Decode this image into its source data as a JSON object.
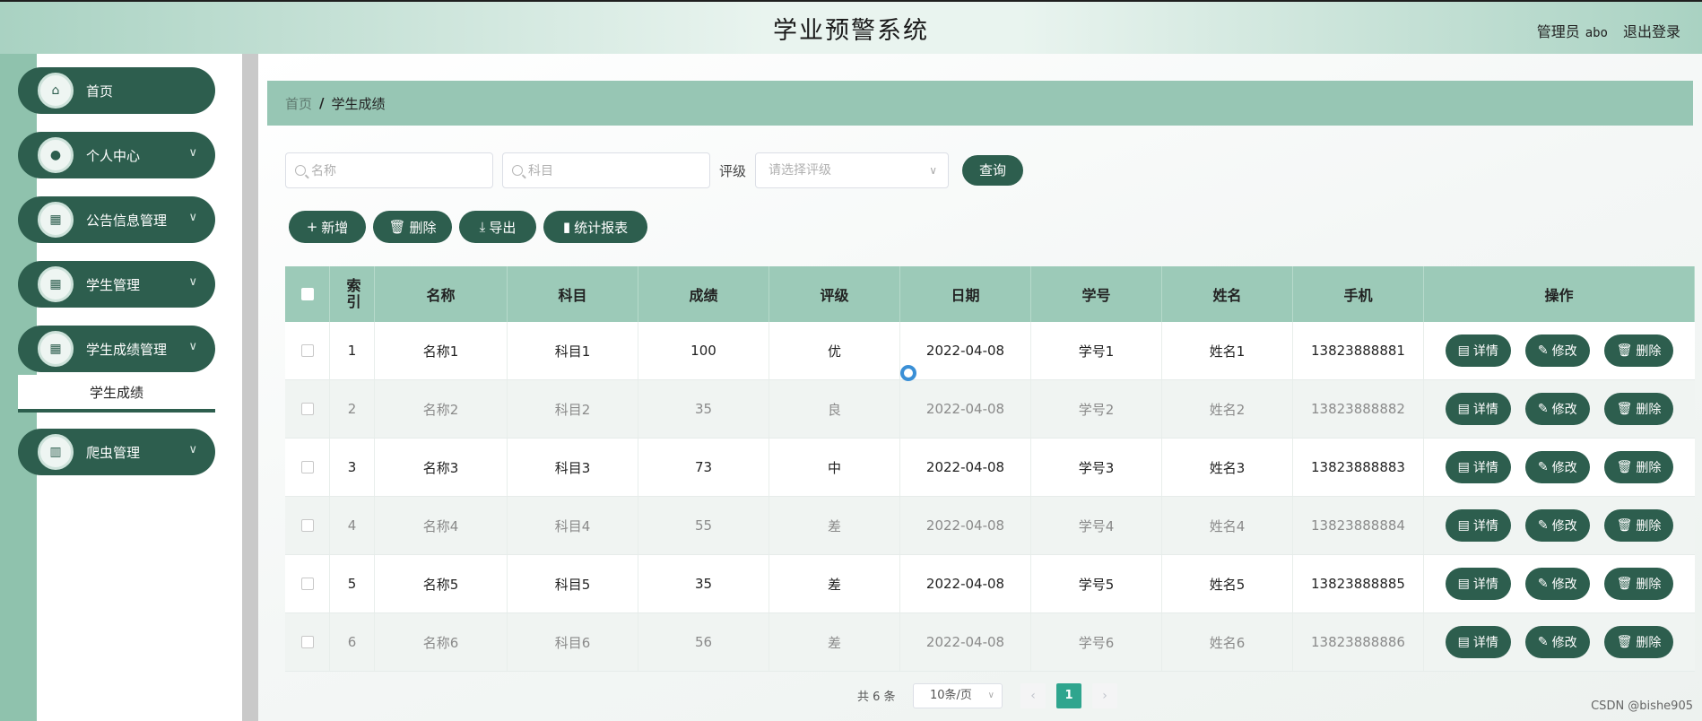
{
  "header": {
    "title": "学业预警系统",
    "user_label": "管理员",
    "username": "abo",
    "logout": "退出登录"
  },
  "sidebar": {
    "items": [
      {
        "label": "首页",
        "icon": "home-icon",
        "glyph": "⌂"
      },
      {
        "label": "个人中心",
        "icon": "user-icon",
        "glyph": "●"
      },
      {
        "label": "公告信息管理",
        "icon": "grid-icon",
        "glyph": "▦"
      },
      {
        "label": "学生管理",
        "icon": "grid-icon",
        "glyph": "▦"
      },
      {
        "label": "学生成绩管理",
        "icon": "apps-icon",
        "glyph": "▦"
      },
      {
        "label": "爬虫管理",
        "icon": "columns-icon",
        "glyph": "▥"
      }
    ],
    "active_sub": "学生成绩"
  },
  "breadcrumb": {
    "home": "首页",
    "current": "学生成绩"
  },
  "search": {
    "name_placeholder": "名称",
    "subject_placeholder": "科目",
    "rating_label": "评级",
    "rating_placeholder": "请选择评级",
    "query": "查询"
  },
  "toolbar": {
    "add": "新增",
    "delete": "删除",
    "export": "导出",
    "report": "统计报表"
  },
  "table": {
    "headers": {
      "index": "索引",
      "name": "名称",
      "subject": "科目",
      "score": "成绩",
      "rating": "评级",
      "date": "日期",
      "student_no": "学号",
      "student_name": "姓名",
      "phone": "手机",
      "ops": "操作"
    },
    "rows": [
      {
        "index": "1",
        "name": "名称1",
        "subject": "科目1",
        "score": "100",
        "rating": "优",
        "date": "2022-04-08",
        "student_no": "学号1",
        "student_name": "姓名1",
        "phone": "13823888881"
      },
      {
        "index": "2",
        "name": "名称2",
        "subject": "科目2",
        "score": "35",
        "rating": "良",
        "date": "2022-04-08",
        "student_no": "学号2",
        "student_name": "姓名2",
        "phone": "13823888882"
      },
      {
        "index": "3",
        "name": "名称3",
        "subject": "科目3",
        "score": "73",
        "rating": "中",
        "date": "2022-04-08",
        "student_no": "学号3",
        "student_name": "姓名3",
        "phone": "13823888883"
      },
      {
        "index": "4",
        "name": "名称4",
        "subject": "科目4",
        "score": "55",
        "rating": "差",
        "date": "2022-04-08",
        "student_no": "学号4",
        "student_name": "姓名4",
        "phone": "13823888884"
      },
      {
        "index": "5",
        "name": "名称5",
        "subject": "科目5",
        "score": "35",
        "rating": "差",
        "date": "2022-04-08",
        "student_no": "学号5",
        "student_name": "姓名5",
        "phone": "13823888885"
      },
      {
        "index": "6",
        "name": "名称6",
        "subject": "科目6",
        "score": "56",
        "rating": "差",
        "date": "2022-04-08",
        "student_no": "学号6",
        "student_name": "姓名6",
        "phone": "13823888886"
      }
    ],
    "actions": {
      "detail": "详情",
      "edit": "修改",
      "delete": "删除"
    }
  },
  "pagination": {
    "total_text": "共 6 条",
    "page_size": "10条/页",
    "current_page": "1",
    "prev": "‹",
    "next": "›"
  },
  "watermark": "CSDN @bishe905",
  "colors": {
    "primary": "#2d5e4e",
    "header_bg": "#a9d2c2",
    "table_head": "#9ccab8",
    "page_active": "#2fa58e"
  }
}
